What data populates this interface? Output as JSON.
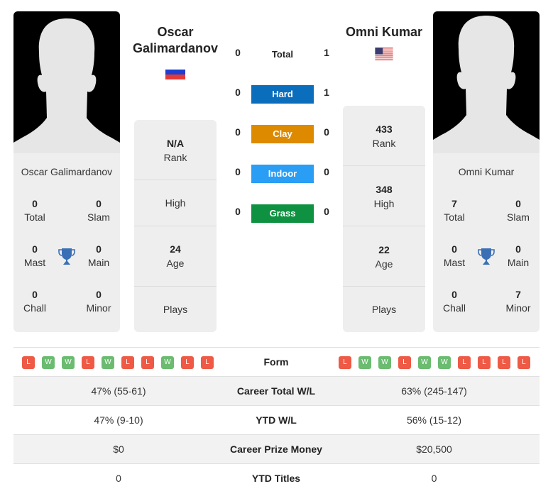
{
  "players": {
    "left": {
      "name": "Oscar Galimardanov",
      "title_line1": "Oscar",
      "title_line2": "Galimardanov",
      "country_flag": "russia-flag",
      "titles": {
        "total": {
          "value": "0",
          "label": "Total"
        },
        "slam": {
          "value": "0",
          "label": "Slam"
        },
        "mast": {
          "value": "0",
          "label": "Mast"
        },
        "main": {
          "value": "0",
          "label": "Main"
        },
        "chall": {
          "value": "0",
          "label": "Chall"
        },
        "minor": {
          "value": "0",
          "label": "Minor"
        }
      },
      "info": {
        "rank": {
          "value": "N/A",
          "label": "Rank"
        },
        "high": {
          "value": "",
          "label": "High"
        },
        "age": {
          "value": "24",
          "label": "Age"
        },
        "plays": {
          "value": "",
          "label": "Plays"
        }
      },
      "form": [
        "L",
        "W",
        "W",
        "L",
        "W",
        "L",
        "L",
        "W",
        "L",
        "L"
      ]
    },
    "right": {
      "name": "Omni Kumar",
      "title_line1": "Omni Kumar",
      "country_flag": "usa-flag",
      "titles": {
        "total": {
          "value": "7",
          "label": "Total"
        },
        "slam": {
          "value": "0",
          "label": "Slam"
        },
        "mast": {
          "value": "0",
          "label": "Mast"
        },
        "main": {
          "value": "0",
          "label": "Main"
        },
        "chall": {
          "value": "0",
          "label": "Chall"
        },
        "minor": {
          "value": "7",
          "label": "Minor"
        }
      },
      "info": {
        "rank": {
          "value": "433",
          "label": "Rank"
        },
        "high": {
          "value": "348",
          "label": "High"
        },
        "age": {
          "value": "22",
          "label": "Age"
        },
        "plays": {
          "value": "",
          "label": "Plays"
        }
      },
      "form": [
        "L",
        "W",
        "W",
        "L",
        "W",
        "W",
        "L",
        "L",
        "L",
        "L"
      ]
    }
  },
  "h2h": [
    {
      "label": "Total",
      "left": "0",
      "right": "1",
      "color": null
    },
    {
      "label": "Hard",
      "left": "0",
      "right": "1",
      "color": "#0a6ebd"
    },
    {
      "label": "Clay",
      "left": "0",
      "right": "0",
      "color": "#dd8a00"
    },
    {
      "label": "Indoor",
      "left": "0",
      "right": "0",
      "color": "#2a9df4"
    },
    {
      "label": "Grass",
      "left": "0",
      "right": "0",
      "color": "#0e9140"
    }
  ],
  "stats": {
    "form_label": "Form",
    "rows": [
      {
        "label": "Career Total W/L",
        "left": "47% (55-61)",
        "right": "63% (245-147)"
      },
      {
        "label": "YTD W/L",
        "left": "47% (9-10)",
        "right": "56% (15-12)"
      },
      {
        "label": "Career Prize Money",
        "left": "$0",
        "right": "$20,500"
      },
      {
        "label": "YTD Titles",
        "left": "0",
        "right": "0"
      }
    ]
  },
  "colors": {
    "win": "#6bbb70",
    "loss": "#ee5a45",
    "trophy": "#3a6fb5",
    "card_bg": "#eeeeee"
  }
}
